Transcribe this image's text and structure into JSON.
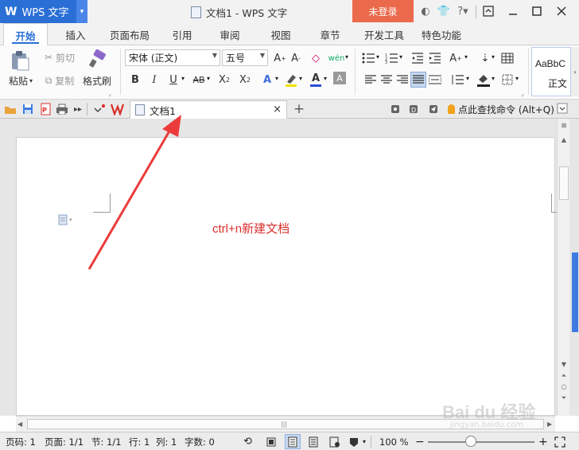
{
  "app": {
    "logo_glyph": "W",
    "name": "WPS 文字",
    "menu_arrow": "▾",
    "window_title": "文档1 - WPS 文字",
    "login_label": "未登录"
  },
  "ribbon_tabs": [
    "开始",
    "插入",
    "页面布局",
    "引用",
    "审阅",
    "视图",
    "章节",
    "开发工具",
    "特色功能"
  ],
  "clipboard": {
    "paste": "粘贴",
    "cut": "剪切",
    "copy": "复制",
    "format_painter": "格式刷"
  },
  "font": {
    "family": "宋体 (正文)",
    "size": "五号"
  },
  "style_preview": {
    "sample": "AaBbC",
    "name": "正文"
  },
  "doc_tab": {
    "title": "文档1",
    "close": "×",
    "add": "+"
  },
  "command_search": "点此查找命令 (Alt+Q)",
  "document": {
    "annotation": "ctrl+n新建文档"
  },
  "status": {
    "page_num": "页码: 1",
    "page": "页面: 1/1",
    "section": "节: 1/1",
    "line": "行: 1",
    "col": "列: 1",
    "words": "字数: 0",
    "zoom": "100 %"
  },
  "zoom_slider": {
    "value_fraction": 0.4
  },
  "colors": {
    "accent": "#2a6fd6",
    "login": "#ec6a4c",
    "annotation": "#d9302c",
    "arrow": "#ec3b3b"
  },
  "watermark": {
    "brand": "Bai du 经验",
    "url": "jingyan.baidu.com"
  }
}
